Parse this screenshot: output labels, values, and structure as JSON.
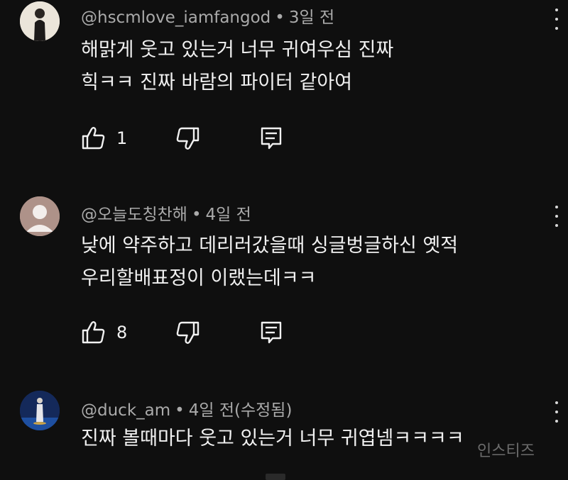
{
  "comments": [
    {
      "handle": "@hscmlove_iamfangod",
      "time": "3일 전",
      "edited": "",
      "lines": [
        "해맑게 웃고 있는거 너무 귀여우심 진짜",
        "힉ㅋㅋ 진짜 바람의 파이터 같아여"
      ],
      "likes": "1"
    },
    {
      "handle": "@오늘도칭찬해",
      "time": "4일 전",
      "edited": "",
      "lines": [
        "낮에 약주하고 데리러갔을때 싱글벙글하신 옛적",
        "우리할배표정이 이랬는데ㅋㅋ"
      ],
      "likes": "8"
    },
    {
      "handle": "@duck_am",
      "time": "4일 전",
      "edited": "(수정됨)",
      "lines": [
        "진짜 볼때마다 웃고 있는거 너무 귀엽넴ㅋㅋㅋㅋ"
      ],
      "likes": ""
    }
  ],
  "watermark": "인스티즈",
  "icons": {
    "like": "thumbs-up-icon",
    "dislike": "thumbs-down-icon",
    "reply": "reply-icon",
    "more": "more-vert-icon"
  },
  "colors": {
    "background": "#0f0f0f",
    "text": "#f1f1f1",
    "meta": "#aaaaaa"
  }
}
